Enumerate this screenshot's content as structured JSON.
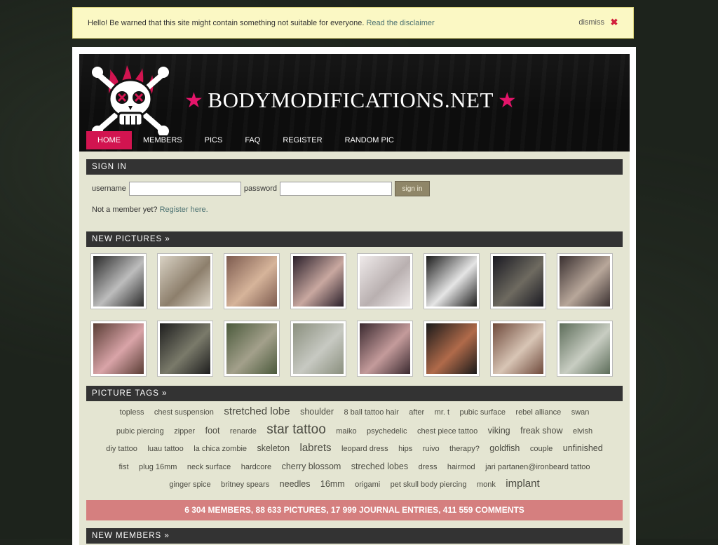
{
  "warning": {
    "message": "Hello! Be warned that this site might contain something not suitable for everyone.",
    "link": "Read the disclaimer",
    "dismiss": "dismiss"
  },
  "header": {
    "site_name": "BODYMODIFICATIONS.NET",
    "logo_icon": "skull-logo",
    "nav": [
      "HOME",
      "MEMBERS",
      "PICS",
      "FAQ",
      "REGISTER",
      "RANDOM PIC"
    ],
    "active_nav": "HOME",
    "accent_color": "#d21450"
  },
  "signin": {
    "title": "SIGN IN",
    "username_label": "username",
    "password_label": "password",
    "button": "sign in",
    "not_member": "Not a member yet?",
    "register_link": "Register here."
  },
  "new_pictures": {
    "title": "NEW PICTURES »"
  },
  "picture_tags": {
    "title": "PICTURE TAGS »",
    "rows": [
      [
        [
          "topless",
          1
        ],
        [
          "chest suspension",
          1
        ],
        [
          "stretched lobe",
          3
        ],
        [
          "shoulder",
          2
        ],
        [
          "8 ball tattoo hair",
          1
        ],
        [
          "after",
          1
        ],
        [
          "mr. t",
          1
        ],
        [
          "pubic surface",
          1
        ],
        [
          "rebel alliance",
          1
        ],
        [
          "swan",
          1
        ]
      ],
      [
        [
          "pubic piercing",
          1
        ],
        [
          "zipper",
          1
        ],
        [
          "foot",
          2
        ],
        [
          "renarde",
          1
        ],
        [
          "star tattoo",
          4
        ],
        [
          "maiko",
          1
        ],
        [
          "psychedelic",
          1
        ],
        [
          "chest piece tattoo",
          1
        ],
        [
          "viking",
          2
        ],
        [
          "freak show",
          2
        ],
        [
          "elvish",
          1
        ]
      ],
      [
        [
          "diy tattoo",
          1
        ],
        [
          "luau tattoo",
          1
        ],
        [
          "la chica zombie",
          1
        ],
        [
          "skeleton",
          2
        ],
        [
          "labrets",
          3
        ],
        [
          "leopard dress",
          1
        ],
        [
          "hips",
          1
        ],
        [
          "ruivo",
          1
        ],
        [
          "therapy?",
          1
        ],
        [
          "goldfish",
          2
        ],
        [
          "couple",
          1
        ],
        [
          "unfinished",
          2
        ]
      ],
      [
        [
          "fist",
          1
        ],
        [
          "plug 16mm",
          1
        ],
        [
          "neck surface",
          1
        ],
        [
          "hardcore",
          1
        ],
        [
          "cherry blossom",
          2
        ],
        [
          "streched lobes",
          2
        ],
        [
          "dress",
          1
        ],
        [
          "hairmod",
          1
        ],
        [
          "jari partanen@ironbeard tattoo",
          1
        ]
      ],
      [
        [
          "ginger spice",
          1
        ],
        [
          "britney spears",
          1
        ],
        [
          "needles",
          2
        ],
        [
          "16mm",
          2
        ],
        [
          "origami",
          1
        ],
        [
          "pet skull body piercing",
          1
        ],
        [
          "monk",
          1
        ],
        [
          "implant",
          3
        ]
      ]
    ]
  },
  "stats": "6 304 MEMBERS, 88 633 PICTURES, 17 999 JOURNAL ENTRIES, 411 559 COMMENTS",
  "new_members": {
    "title": "NEW MEMBERS »"
  }
}
